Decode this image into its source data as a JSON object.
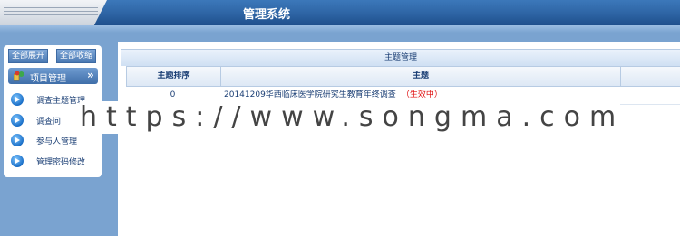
{
  "header": {
    "title": "管理系统"
  },
  "sidebar": {
    "expand_all": "全部展开",
    "collapse_all": "全部收缩",
    "menu_header": "项目管理",
    "items": [
      {
        "label": "调查主题管理"
      },
      {
        "label": "调查问"
      },
      {
        "label": "参与人管理"
      },
      {
        "label": "管理密码修改"
      }
    ]
  },
  "main": {
    "panel_title": "主题管理",
    "columns": [
      "主题排序",
      "主题"
    ],
    "rows": [
      {
        "order": "0",
        "topic": "20141209华西临床医学院研究生教育年终调查",
        "status": "（生效中）"
      }
    ]
  },
  "watermark": "https://www.songma.com",
  "colors": {
    "status_active": "#e01010",
    "header_bg": "#2d64a4",
    "page_bg": "#7aa3d0"
  }
}
